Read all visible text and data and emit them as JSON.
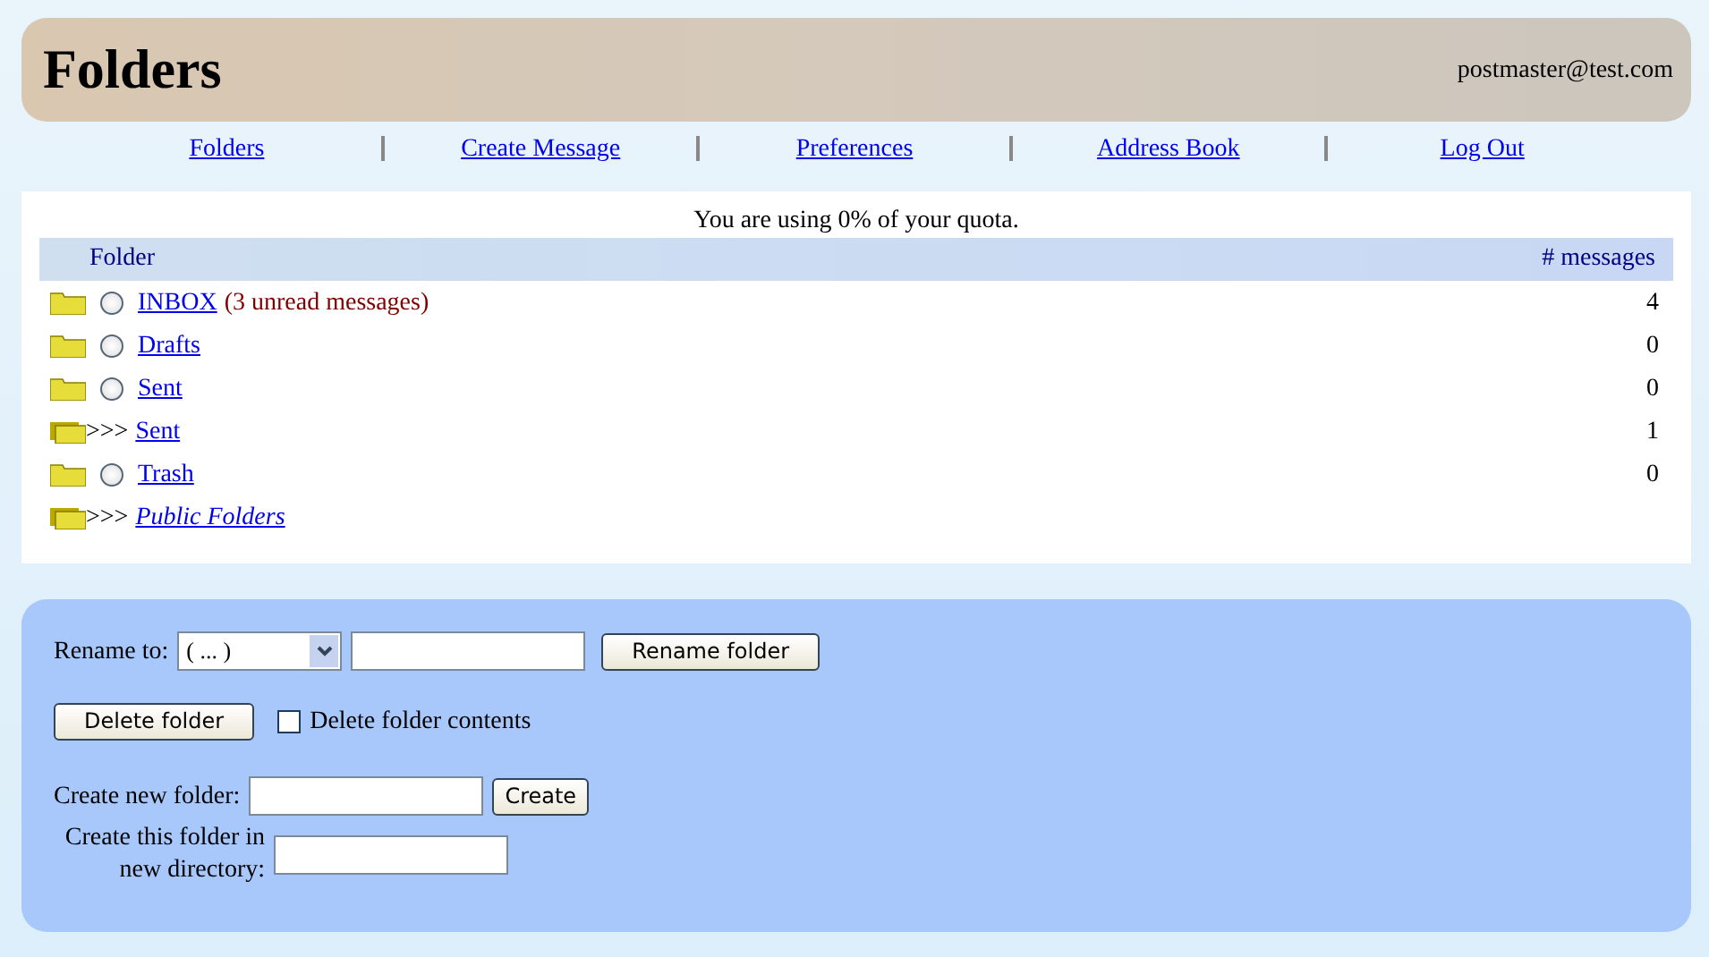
{
  "header": {
    "title": "Folders",
    "user": "postmaster@test.com"
  },
  "nav": [
    "Folders",
    "Create Message",
    "Preferences",
    "Address Book",
    "Log Out"
  ],
  "quota": "You are using 0% of your quota.",
  "table": {
    "columns": [
      "Folder",
      "# messages"
    ],
    "rows": [
      {
        "kind": "mailbox",
        "name": "INBOX",
        "note": "(3 unread messages)",
        "count": "4",
        "selected": false
      },
      {
        "kind": "mailbox",
        "name": "Drafts",
        "count": "0",
        "selected": false
      },
      {
        "kind": "mailbox",
        "name": "Sent",
        "count": "0",
        "selected": false
      },
      {
        "kind": "parent",
        "prefix": ">>>",
        "name": "Sent",
        "count": "1"
      },
      {
        "kind": "mailbox",
        "name": "Trash",
        "count": "0",
        "selected": false
      },
      {
        "kind": "namespace",
        "prefix": ">>>",
        "name": "Public Folders"
      }
    ]
  },
  "actions": {
    "rename": {
      "label": "Rename to:",
      "select_value": "( ... )",
      "button": "Rename folder"
    },
    "delete": {
      "button": "Delete folder",
      "checkbox_label": "Delete folder contents",
      "checked": false
    },
    "create": {
      "label": "Create new folder:",
      "button": "Create"
    },
    "directory": {
      "label": "Create this folder in new directory:"
    }
  }
}
